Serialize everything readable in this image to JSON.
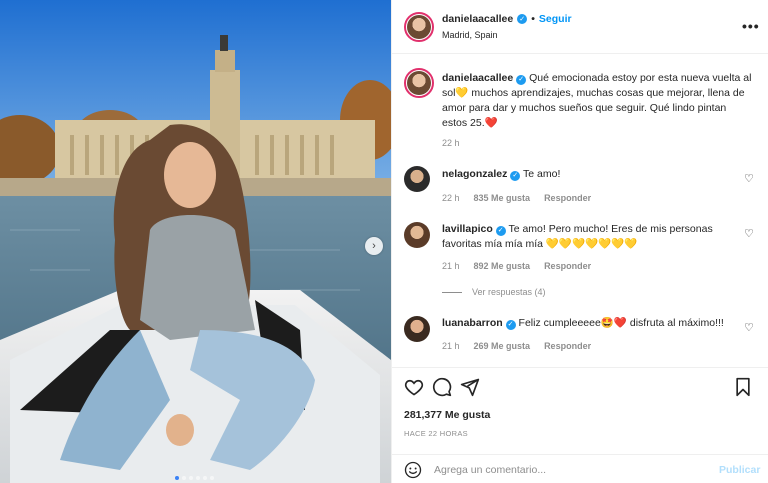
{
  "post": {
    "username": "danielaacallee",
    "follow_label": "Seguir",
    "location": "Madrid, Spain",
    "more_icon": "more-horizontal-icon",
    "caption_text": "Qué emocionada estoy por esta nueva vuelta al sol💛 muchos aprendizajes, muchas cosas que mejorar, llena de amor para dar y muchos sueños que seguir. Qué lindo pintan estos 25.❤️",
    "caption_time": "22 h",
    "likes": "281,377 Me gusta",
    "posted_ago": "HACE 22 HORAS",
    "add_comment_placeholder": "Agrega un comentario...",
    "publish_label": "Publicar",
    "carousel_dots": 6,
    "active_dot": 0
  },
  "comments": [
    {
      "username": "nelagonzalez",
      "text": "Te amo!",
      "time": "22 h",
      "likes": "835 Me gusta",
      "reply": "Responder"
    },
    {
      "username": "lavillapico",
      "text": "Te amo! Pero mucho! Eres de mis personas favoritas mía mía mía 💛💛💛💛💛💛💛",
      "time": "21 h",
      "likes": "892 Me gusta",
      "reply": "Responder",
      "view_replies": "Ver respuestas (4)"
    },
    {
      "username": "luanabarron",
      "text": "Feliz cumpleeeee🤩❤️ disfruta al máximo!!!",
      "time": "21 h",
      "likes": "269 Me gusta",
      "reply": "Responder"
    }
  ],
  "colors": {
    "follow_blue": "#0095f6",
    "verified_blue": "#1d9bf0",
    "muted": "#8e8e8e",
    "publish_disabled": "#b2dffc"
  }
}
